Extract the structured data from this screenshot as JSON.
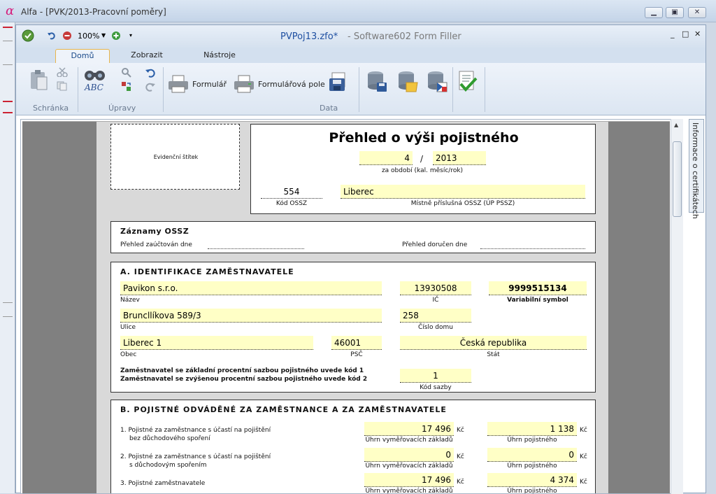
{
  "outer_window": {
    "title": "Alfa - [PVK/2013-Pracovní poměry]",
    "logo_char": "α",
    "minimize": "▁",
    "maximize": "▣",
    "close": "✕"
  },
  "app": {
    "zoom": "100%",
    "doc_name": "PVPoj13.zfo*",
    "separator": "-",
    "program": "Software602 Form Filler",
    "ctl_min": "_",
    "ctl_max": "□",
    "ctl_close": "✕"
  },
  "tabs": [
    {
      "label": "Domů"
    },
    {
      "label": "Zobrazit"
    },
    {
      "label": "Nástroje"
    }
  ],
  "ribbon": {
    "groups": {
      "clipboard": "Schránka",
      "edit": "Úpravy",
      "data": "Data"
    },
    "buttons": {
      "form": "Formulář",
      "form_fields": "Formulářová pole"
    },
    "spell_label": "ABC"
  },
  "sidebar_tab": "Informace o certifikátech",
  "form": {
    "sticker_label": "Evidenční štítek",
    "title": "Přehled o výši pojistného",
    "period_month": "4",
    "period_slash": "/",
    "period_year": "2013",
    "period_caption": "za období (kal. měsíc/rok)",
    "ossz_code": "554",
    "ossz_code_label": "Kód OSSZ",
    "ossz_place": "Liberec",
    "ossz_place_label": "Místně příslušná OSSZ (ÚP PSSZ)",
    "records": {
      "title": "Záznamy OSSZ",
      "charged_label": "Přehled zaúčtován dne",
      "delivered_label": "Přehled doručen dne"
    },
    "section_a": {
      "title": "A. IDENTIFIKACE ZAMĚSTNAVATELE",
      "name": "Pavikon s.r.o.",
      "name_label": "Název",
      "ico": "13930508",
      "ico_label": "IČ",
      "varsym": "9999515134",
      "varsym_label": "Variabilní symbol",
      "street": "Bruncllíkova 589/3",
      "street_label": "Ulice",
      "house_no": "258",
      "house_no_label": "Číslo domu",
      "city": "Liberec 1",
      "city_label": "Obec",
      "zip": "46001",
      "zip_label": "PSČ",
      "country": "Česká republika",
      "country_label": "Stát",
      "rate_line1": "Zaměstnavatel se základní procentní sazbou pojistného uvede kód 1",
      "rate_line2": "Zaměstnavatel se zvýšenou procentní sazbou pojistného uvede kód 2",
      "rate_code": "1",
      "rate_code_label": "Kód sazby"
    },
    "section_b": {
      "title": "B. POJISTNÉ ODVÁDĚNÉ ZA ZAMĚSTNANCE A ZA ZAMĚSTNAVATELE",
      "currency": "Kč",
      "base_label": "Úhrn vyměřovacích základů",
      "insurance_label": "Úhrn pojistného",
      "rows": [
        {
          "line1": "1. Pojistné za zaměstnance s účastí na pojištění",
          "line2": "bez důchodového spoření",
          "base": "17 496",
          "insurance": "1 138"
        },
        {
          "line1": "2. Pojistné za zaměstnance s účastí na pojištění",
          "line2": "s důchodovým spořením",
          "base": "0",
          "insurance": "0"
        },
        {
          "line1": "3. Pojistné zaměstnavatele",
          "line2": "",
          "base": "17 496",
          "insurance": "4 374"
        }
      ]
    }
  }
}
